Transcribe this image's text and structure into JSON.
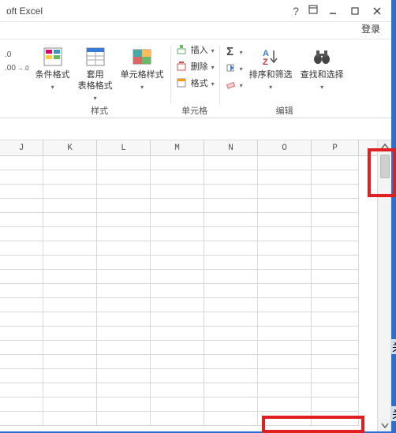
{
  "title": "oft Excel",
  "login": "登录",
  "ribbon": {
    "num": {
      "inc": ".0",
      "dec": ".00",
      "inc2": ".00",
      "dec2": ".0"
    },
    "styles": {
      "conditional": "条件格式",
      "table": "套用\n表格格式",
      "cell": "单元格样式",
      "group": "样式"
    },
    "cells": {
      "insert": "插入",
      "delete": "删除",
      "format": "格式",
      "group": "单元格"
    },
    "editing": {
      "sort": "排序和筛选",
      "find": "查找和选择",
      "group": "编辑"
    }
  },
  "columns": [
    "J",
    "K",
    "L",
    "M",
    "N",
    "O",
    "P"
  ],
  "hints": {
    "h1": "关",
    "h2": "关"
  }
}
